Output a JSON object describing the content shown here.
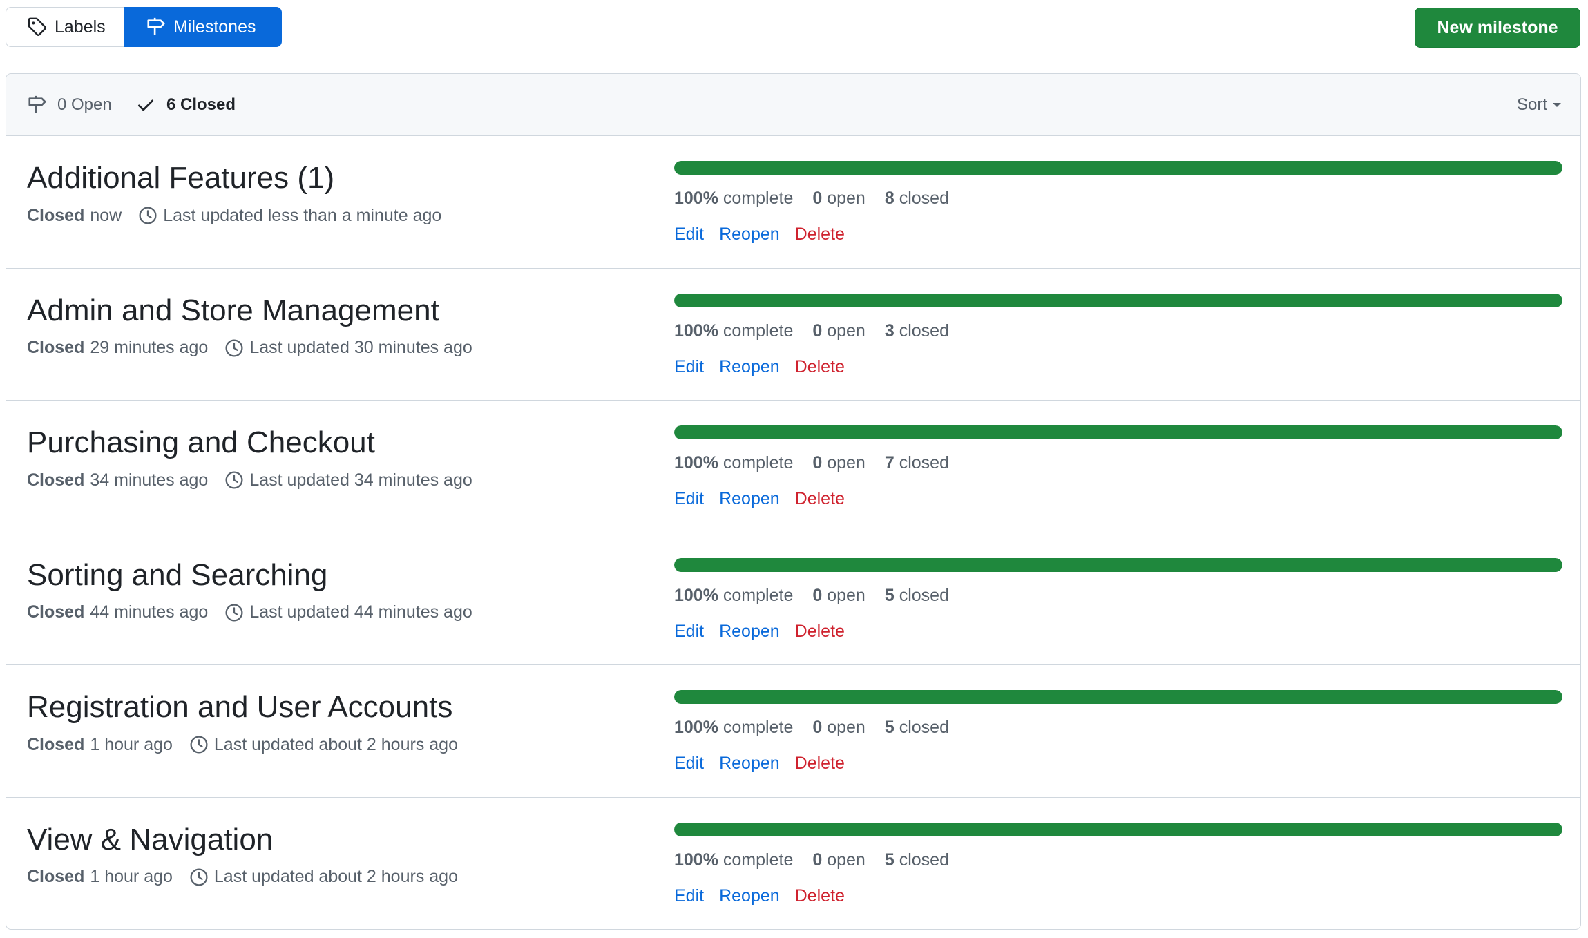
{
  "nav": {
    "labels_tab": "Labels",
    "milestones_tab": "Milestones",
    "new_milestone_button": "New milestone"
  },
  "filters": {
    "open_label": "0 Open",
    "closed_label": "6 Closed",
    "sort_label": "Sort"
  },
  "colors": {
    "accent": "#0969da",
    "primary_button": "#1f883d",
    "progress": "#1f883d",
    "danger": "#cf222e"
  },
  "milestones": [
    {
      "title": "Additional Features (1)",
      "closed_label": "Closed",
      "closed_when": "now",
      "updated": "Last updated less than a minute ago",
      "progress_percent": 100,
      "complete": "100%",
      "complete_label": "complete",
      "open_count": "0",
      "open_label": "open",
      "closed_count": "8",
      "closed_count_label": "closed",
      "edit": "Edit",
      "reopen": "Reopen",
      "delete": "Delete"
    },
    {
      "title": "Admin and Store Management",
      "closed_label": "Closed",
      "closed_when": "29 minutes ago",
      "updated": "Last updated 30 minutes ago",
      "progress_percent": 100,
      "complete": "100%",
      "complete_label": "complete",
      "open_count": "0",
      "open_label": "open",
      "closed_count": "3",
      "closed_count_label": "closed",
      "edit": "Edit",
      "reopen": "Reopen",
      "delete": "Delete"
    },
    {
      "title": "Purchasing and Checkout",
      "closed_label": "Closed",
      "closed_when": "34 minutes ago",
      "updated": "Last updated 34 minutes ago",
      "progress_percent": 100,
      "complete": "100%",
      "complete_label": "complete",
      "open_count": "0",
      "open_label": "open",
      "closed_count": "7",
      "closed_count_label": "closed",
      "edit": "Edit",
      "reopen": "Reopen",
      "delete": "Delete"
    },
    {
      "title": "Sorting and Searching",
      "closed_label": "Closed",
      "closed_when": "44 minutes ago",
      "updated": "Last updated 44 minutes ago",
      "progress_percent": 100,
      "complete": "100%",
      "complete_label": "complete",
      "open_count": "0",
      "open_label": "open",
      "closed_count": "5",
      "closed_count_label": "closed",
      "edit": "Edit",
      "reopen": "Reopen",
      "delete": "Delete"
    },
    {
      "title": "Registration and User Accounts",
      "closed_label": "Closed",
      "closed_when": "1 hour ago",
      "updated": "Last updated about 2 hours ago",
      "progress_percent": 100,
      "complete": "100%",
      "complete_label": "complete",
      "open_count": "0",
      "open_label": "open",
      "closed_count": "5",
      "closed_count_label": "closed",
      "edit": "Edit",
      "reopen": "Reopen",
      "delete": "Delete"
    },
    {
      "title": "View & Navigation",
      "closed_label": "Closed",
      "closed_when": "1 hour ago",
      "updated": "Last updated about 2 hours ago",
      "progress_percent": 100,
      "complete": "100%",
      "complete_label": "complete",
      "open_count": "0",
      "open_label": "open",
      "closed_count": "5",
      "closed_count_label": "closed",
      "edit": "Edit",
      "reopen": "Reopen",
      "delete": "Delete"
    }
  ]
}
